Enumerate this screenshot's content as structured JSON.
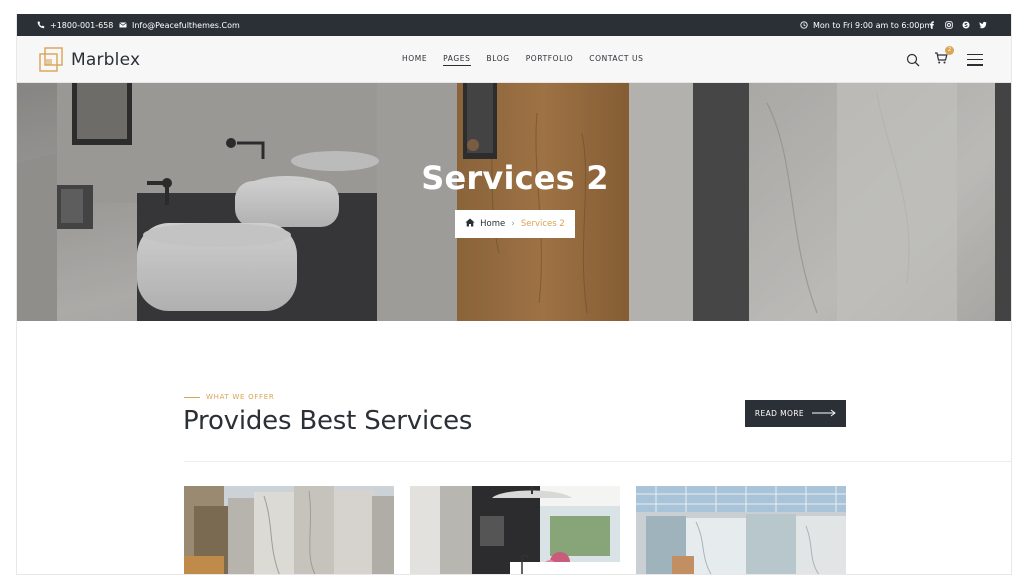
{
  "topbar": {
    "phone": "+1800-001-658",
    "email": "Info@Peacefulthemes.Com",
    "hours": "Mon to Fri 9:00 am to 6:00pm",
    "social_icons": [
      "facebook-icon",
      "instagram-icon",
      "skype-icon",
      "twitter-icon"
    ]
  },
  "header": {
    "logo_text": "Marblex",
    "nav": [
      {
        "label": "HOME",
        "active": false
      },
      {
        "label": "PAGES",
        "active": true
      },
      {
        "label": "BLOG",
        "active": false
      },
      {
        "label": "PORTFOLIO",
        "active": false
      },
      {
        "label": "CONTACT US",
        "active": false
      }
    ],
    "cart_count": "2"
  },
  "hero": {
    "title": "Services 2",
    "breadcrumb": {
      "home": "Home",
      "current": "Services 2"
    }
  },
  "section": {
    "eyebrow": "WHAT WE OFFER",
    "title": "Provides Best Services",
    "read_more": "READ MORE"
  },
  "colors": {
    "dark": "#2b3036",
    "accent": "#d9a453",
    "white": "#ffffff"
  }
}
